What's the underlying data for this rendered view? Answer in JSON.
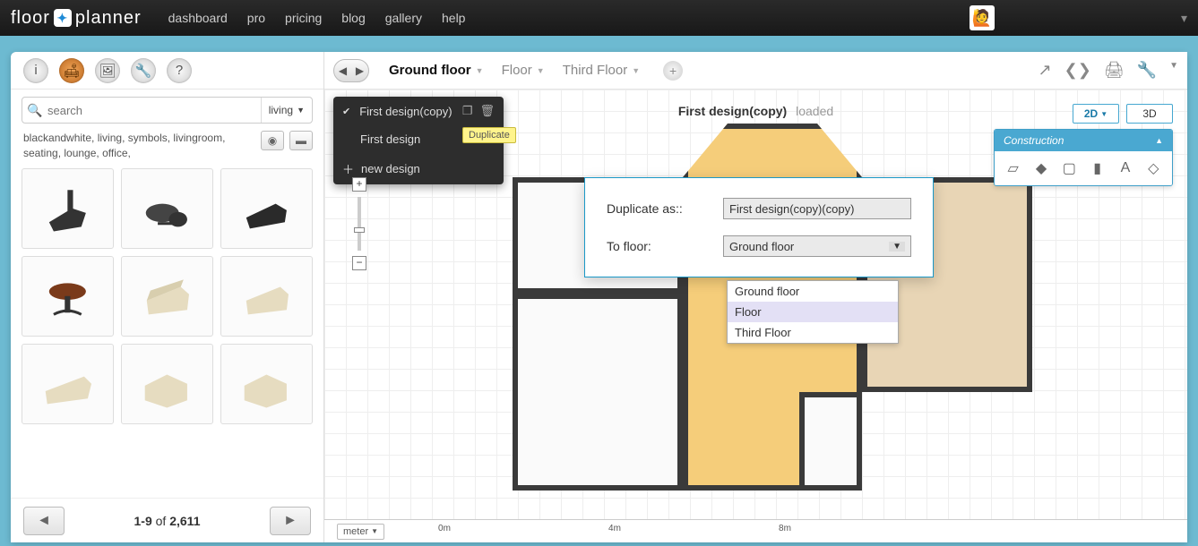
{
  "app": {
    "logo_left": "floor",
    "logo_right": "planner"
  },
  "nav": [
    "dashboard",
    "pro",
    "pricing",
    "blog",
    "gallery",
    "help"
  ],
  "sidebar": {
    "search_placeholder": "search",
    "filter": "living",
    "tags": "blackandwhite, living, symbols, livingroom, seating, lounge, office,",
    "pager_range": "1-9",
    "pager_of": "of",
    "pager_total": "2,611"
  },
  "floors": {
    "tabs": [
      "Ground floor",
      "Floor",
      "Third Floor"
    ]
  },
  "design_menu": {
    "items": [
      "First design(copy)",
      "First design",
      "new design"
    ],
    "tooltip": "Duplicate"
  },
  "canvas_title": {
    "name": "First design(copy)",
    "status": "loaded"
  },
  "dialog": {
    "label_name": "Duplicate as::",
    "name_value": "First design(copy)(copy)",
    "label_floor": "To floor:",
    "floor_value": "Ground floor",
    "options": [
      "Ground floor",
      "Floor",
      "Third Floor"
    ],
    "hover_index": 1
  },
  "view": {
    "d2": "2D",
    "d3": "3D"
  },
  "construction": {
    "title": "Construction"
  },
  "ruler": {
    "unit": "meter",
    "marks": [
      "0m",
      "4m",
      "8m"
    ]
  }
}
